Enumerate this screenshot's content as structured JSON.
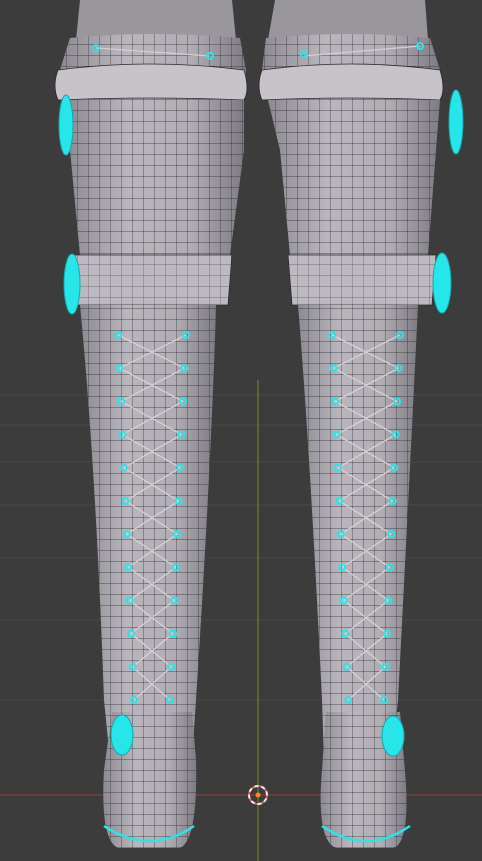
{
  "viewport": {
    "mode": "edit-mode-wireframe-overlay",
    "colors": {
      "background": "#3c3c3c",
      "grid": "#474747",
      "x_axis": "#9c3a3a",
      "y_axis": "#6b8f2a",
      "mesh_fill": "#b3afb6",
      "mesh_fill_dark": "#8f8b93",
      "wire": "#2a2a2e",
      "selection": "#27e6ea",
      "origin": "#f28a1c",
      "cursor_red": "#e05a4f",
      "cursor_white": "#f2f2f2"
    },
    "objects": [
      {
        "name": "boot-left",
        "visible": true
      },
      {
        "name": "boot-right",
        "visible": true
      }
    ],
    "selected_parts": [
      "buckle-upper",
      "buckle-mid",
      "buckle-ankle",
      "eyelets",
      "sole-rim"
    ]
  }
}
